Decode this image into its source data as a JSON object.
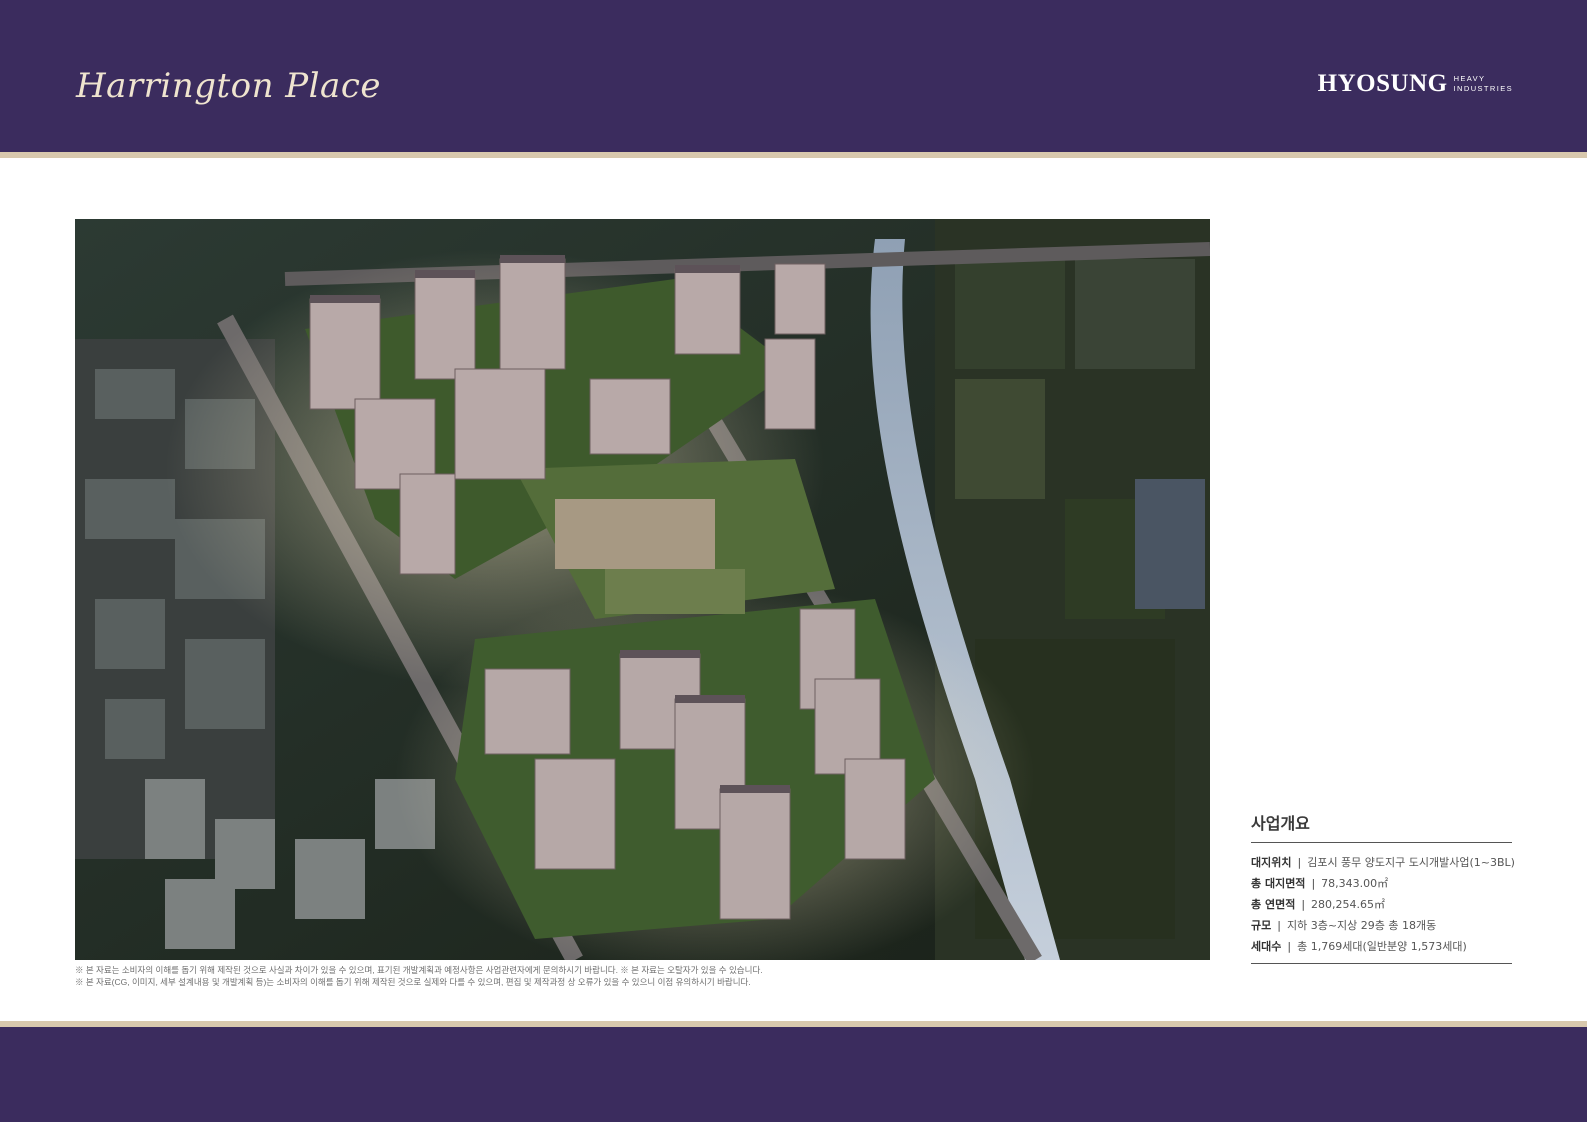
{
  "header": {
    "brand": "Harrington Place",
    "logo_main": "HYOSUNG",
    "logo_sub_1": "HEAVY",
    "logo_sub_2": "INDUSTRIES"
  },
  "notes": [
    "※ 본 자료는 소비자의 이해를 돕기 위해 제작된 것으로 사실과 차이가 있을 수 있으며, 표기된 개발계획과 예정사항은 사업관련자에게 문의하시기 바랍니다. ※ 본 자료는 오탈자가 있을 수 있습니다.",
    "※ 본 자료(CG, 이미지, 세부 설계내용 및 개발계획 등)는 소비자의 이해를 돕기 위해 제작된 것으로 실제와 다를 수 있으며, 편집 및 제작과정 상 오류가 있을 수 있으니 이점 유의하시기 바랍니다."
  ],
  "overview": {
    "title": "사업개요",
    "rows": [
      {
        "label": "대지위치",
        "value": "김포시 풍무 양도지구 도시개발사업(1~3BL)"
      },
      {
        "label": "총 대지면적",
        "value": "78,343.00㎡"
      },
      {
        "label": "총 연면적",
        "value": "280,254.65㎡"
      },
      {
        "label": "규모",
        "value": "지하 3층~지상 29층 총 18개동"
      },
      {
        "label": "세대수",
        "value": "총 1,769세대(일반분양 1,573세대)"
      }
    ]
  },
  "colors": {
    "navy": "#3b2c5e",
    "gold_rule": "#d8c8ad",
    "brand_text": "#efe4cf"
  }
}
